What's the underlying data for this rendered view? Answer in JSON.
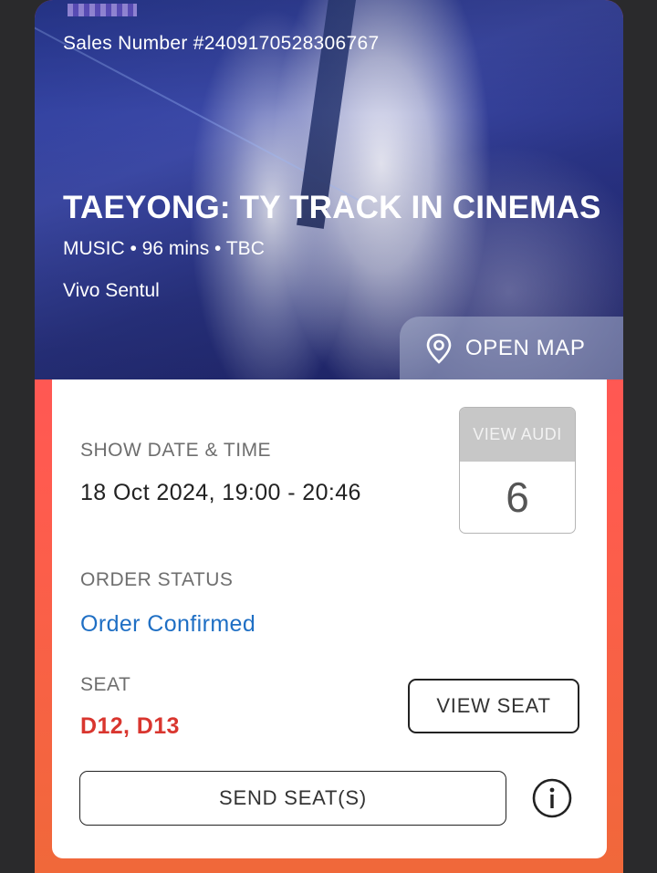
{
  "hero": {
    "sales_number": "Sales Number #24091705283067​67",
    "title": "TAEYONG: TY TRACK IN CINEMAS",
    "meta": "MUSIC • 96 mins • TBC",
    "venue": "Vivo Sentul",
    "open_map_label": "OPEN MAP",
    "open_map_icon": "map-pin-icon"
  },
  "details": {
    "show_date_label": "SHOW DATE & TIME",
    "show_date_value": "18 Oct 2024, 19:00 - 20:46",
    "audi_label": "VIEW AUDI",
    "audi_number": "6",
    "order_status_label": "ORDER STATUS",
    "order_status_value": "Order Confirmed",
    "seat_label": "SEAT",
    "seat_value": "D12, D13",
    "view_seat_label": "VIEW SEAT",
    "send_seats_label": "SEND SEAT(S)",
    "info_icon": "info-icon"
  },
  "colors": {
    "order_status": "#1f6fc4",
    "seat_value": "#d9362f",
    "card_gradient_start": "#ff4a63",
    "card_gradient_end": "#f0683a"
  }
}
